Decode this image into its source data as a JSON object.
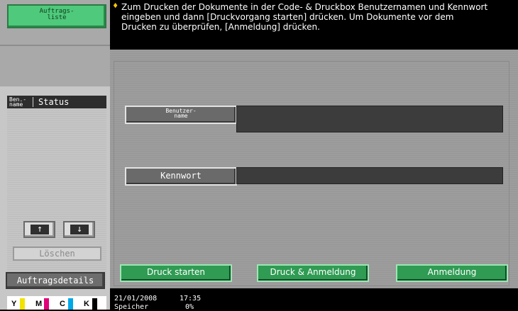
{
  "left_panel": {
    "job_list_button": {
      "line1": "Auftrags-",
      "line2": "liste"
    },
    "list_header": {
      "col1_line1": "Ben.-",
      "col1_line2": "name",
      "col2": "Status"
    },
    "scroll_up_arrow": "↑",
    "scroll_down_arrow": "↓",
    "delete_button": "Löschen",
    "job_details_button": "Auftragsdetails",
    "toner": [
      {
        "label": "Y",
        "color": "#f1e300"
      },
      {
        "label": "M",
        "color": "#e0007a"
      },
      {
        "label": "C",
        "color": "#00a8e8"
      },
      {
        "label": "K",
        "color": "#000000"
      }
    ]
  },
  "message": {
    "icon": "♦",
    "line1": "Zum Drucken der Dokumente in der Code- & Druckbox Benutzernamen und Kennwort",
    "line2": "eingeben und dann [Druckvorgang starten] drücken. Um Dokumente vor dem",
    "line3": "Drucken zu überprüfen, [Anmeldung] drücken."
  },
  "form": {
    "username_button": {
      "line1": "Benutzer-",
      "line2": "name"
    },
    "username_value": "",
    "password_button": "Kennwort",
    "password_value": ""
  },
  "actions": {
    "start_print": "Druck starten",
    "print_and_login": "Druck & Anmeldung",
    "login": "Anmeldung"
  },
  "status_bar": {
    "date": "21/01/2008",
    "time": "17:35",
    "memory_label": "Speicher",
    "memory_value": "0%"
  }
}
